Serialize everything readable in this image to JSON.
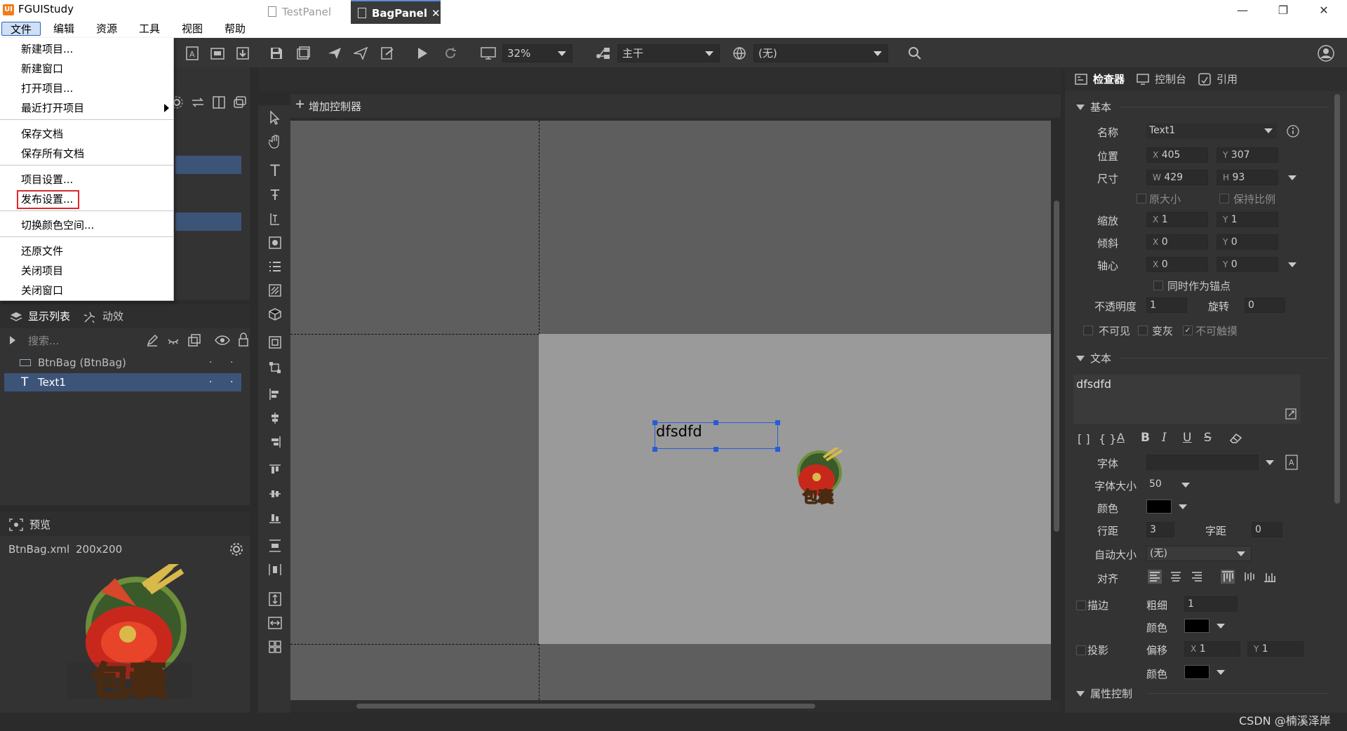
{
  "window": {
    "title": "FGUIStudy",
    "logo": "UI",
    "minimize": "—",
    "maximize": "❐",
    "close": "✕"
  },
  "menubar": [
    "文件",
    "编辑",
    "资源",
    "工具",
    "视图",
    "帮助"
  ],
  "file_menu": {
    "items": [
      "新建项目...",
      "新建窗口",
      "打开项目...",
      "最近打开项目",
      "保存文档",
      "保存所有文档",
      "项目设置...",
      "发布设置...",
      "切换颜色空间...",
      "还原文件",
      "关闭项目",
      "关闭窗口"
    ],
    "highlighted": "发布设置..."
  },
  "toolbar": {
    "zoom": "32%",
    "branch": "主干",
    "language": "(无)"
  },
  "display_list": {
    "tabs": [
      "显示列表",
      "动效"
    ],
    "search_placeholder": "搜索...",
    "items": [
      {
        "name": "BtnBag (BtnBag)",
        "selected": false
      },
      {
        "name": "Text1",
        "selected": true
      }
    ]
  },
  "preview": {
    "title": "预览",
    "file": "BtnBag.xml",
    "size": "200x200",
    "image_caption": "包囊"
  },
  "editor": {
    "tabs": [
      "TestPanel",
      "BagPanel"
    ],
    "active_tab": "BagPanel",
    "add_controller": "增加控制器",
    "text_content": "dfsdfd"
  },
  "inspector": {
    "tabs": [
      "检查器",
      "控制台",
      "引用"
    ],
    "basic": {
      "header": "基本",
      "name_label": "名称",
      "name": "Text1",
      "pos_label": "位置",
      "x": "405",
      "y": "307",
      "size_label": "尺寸",
      "w": "429",
      "h": "93",
      "orig_size": "原大小",
      "keep_ratio": "保持比例",
      "scale_label": "缩放",
      "scale_x": "1",
      "scale_y": "1",
      "skew_label": "倾斜",
      "skew_x": "0",
      "skew_y": "0",
      "pivot_label": "轴心",
      "pivot_x": "0",
      "pivot_y": "0",
      "as_anchor": "同时作为锚点",
      "opacity_label": "不透明度",
      "opacity": "1",
      "rotation_label": "旋转",
      "rotation": "0",
      "invisible": "不可见",
      "grayed": "变灰",
      "untouchable": "不可触摸"
    },
    "text": {
      "header": "文本",
      "content": "dfsdfd",
      "font_label": "字体",
      "font": "",
      "font_size_label": "字体大小",
      "font_size": "50",
      "color_label": "颜色",
      "color": "#000000",
      "line_spacing_label": "行距",
      "line_spacing": "3",
      "letter_spacing_label": "字距",
      "letter_spacing": "0",
      "autosize_label": "自动大小",
      "autosize": "(无)",
      "align_label": "对齐",
      "stroke_label": "描边",
      "stroke_width_label": "粗细",
      "stroke_width": "1",
      "stroke_color_label": "颜色",
      "shadow_label": "投影",
      "shadow_offset_label": "偏移",
      "shadow_x": "1",
      "shadow_y": "1",
      "shadow_color_label": "颜色"
    },
    "prop_control": "属性控制"
  },
  "axis": {
    "x": "X",
    "y": "Y",
    "w": "W",
    "h": "H"
  },
  "watermark": "CSDN @楠溪泽岸",
  "colors": {
    "accent": "#2a5bd7",
    "selected_row": "#3d5479",
    "highlight_border": "#e0262a"
  }
}
